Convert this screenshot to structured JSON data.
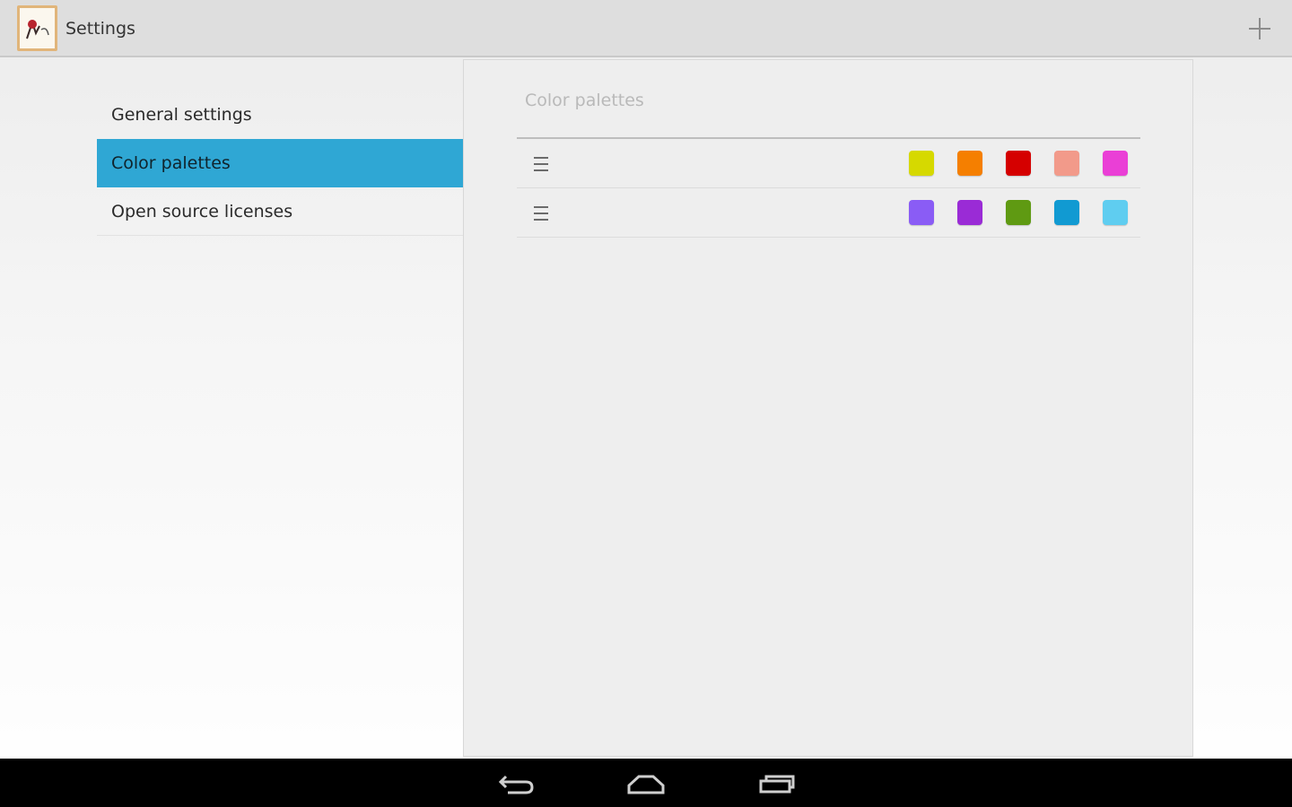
{
  "action_bar": {
    "title": "Settings",
    "app_icon": "app-logo-icon",
    "add_icon": "plus-icon"
  },
  "nav": {
    "items": [
      {
        "label": "General settings",
        "selected": false
      },
      {
        "label": "Color palettes",
        "selected": true
      },
      {
        "label": "Open source licenses",
        "selected": false
      }
    ],
    "selected_color": "#2fa7d4"
  },
  "panel": {
    "header": "Color palettes",
    "drag_icon": "drag-handle-icon",
    "palettes": [
      {
        "colors": [
          "#d6d900",
          "#f57f00",
          "#d50000",
          "#f29a8a",
          "#ea3fd6"
        ]
      },
      {
        "colors": [
          "#8a5cf5",
          "#9a2bd6",
          "#5f9a12",
          "#119ad2",
          "#5fcdf0"
        ]
      }
    ]
  },
  "system_bar": {
    "buttons": [
      "back-icon",
      "home-icon",
      "recent-apps-icon"
    ]
  }
}
